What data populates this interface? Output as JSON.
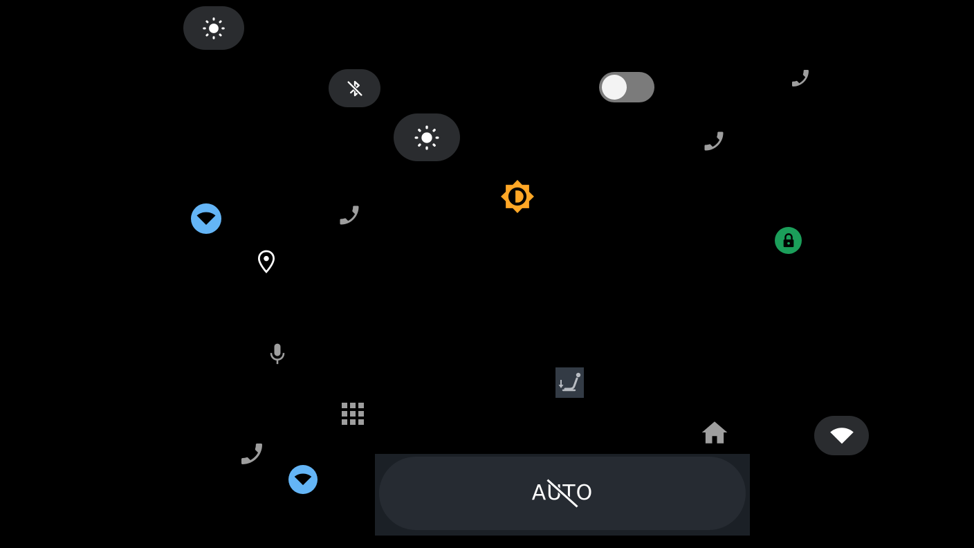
{
  "colors": {
    "background": "#000000",
    "pill_bg": "#2a2c2f",
    "icon_gray": "#9e9e9e",
    "icon_white": "#ffffff",
    "wifi_blue": "#64b5f6",
    "brightness_orange": "#ffa726",
    "lock_green": "#1b9e5a"
  },
  "icons": {
    "brightness_top": "brightness-icon",
    "bluetooth": "bluetooth-off-icon",
    "brightness_mid": "brightness-icon",
    "toggle": "switch-toggle",
    "phone_1": "phone-icon",
    "phone_2": "phone-icon",
    "phone_3": "phone-icon",
    "phone_4": "phone-icon",
    "auto_brightness": "auto-brightness-icon",
    "wifi_1": "wifi-icon",
    "wifi_2": "wifi-icon",
    "wifi_3": "wifi-icon",
    "location": "location-pin-icon",
    "lock": "lock-icon",
    "mic": "microphone-icon",
    "apps": "app-grid-icon",
    "seat": "seat-recline-icon",
    "home": "home-icon"
  },
  "toggle": {
    "state": "off"
  },
  "auto_button": {
    "label": "AUTO",
    "state": "disabled"
  }
}
